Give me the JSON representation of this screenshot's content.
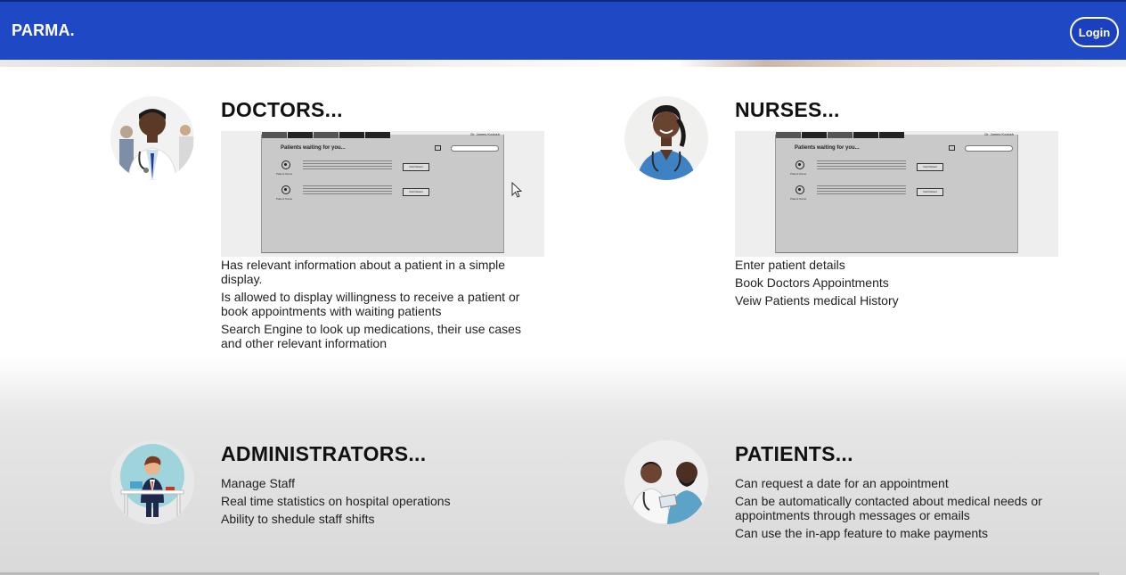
{
  "header": {
    "brand": "PARMA.",
    "login_label": "Login"
  },
  "sections": {
    "doctors": {
      "title": "DOCTORS...",
      "preview": {
        "heading": "Patients waiting for you...",
        "user_name": "Dr. James Kodush",
        "patient_label": "Patient Name",
        "button_label": "Visit Patient"
      },
      "items": [
        "Has relevant information about a patient in a simple display.",
        "Is allowed to display willingness to receive a patient or book appointments with waiting patients",
        "Search Engine to look up medications, their use cases and other relevant information"
      ]
    },
    "nurses": {
      "title": "NURSES...",
      "preview": {
        "heading": "Patients waiting for you...",
        "user_name": "Dr. James Kodush",
        "patient_label": "Patient Name",
        "button_label": "Visit Patient"
      },
      "items": [
        "Enter patient details",
        "Book Doctors Appointments",
        "Veiw Patients medical History"
      ]
    },
    "administrators": {
      "title": "ADMINISTRATORS...",
      "items": [
        "Manage Staff",
        "Real time statistics on hospital operations",
        "Ability to shedule staff shifts"
      ]
    },
    "patients": {
      "title": "PATIENTS...",
      "items": [
        "Can request a date for an appointment",
        "Can be automatically contacted about medical needs or appointments through messages or emails",
        "Can use the in-app feature to make payments"
      ]
    }
  },
  "colors": {
    "navbar": "#1f48c5",
    "text": "#1a1a1a"
  }
}
